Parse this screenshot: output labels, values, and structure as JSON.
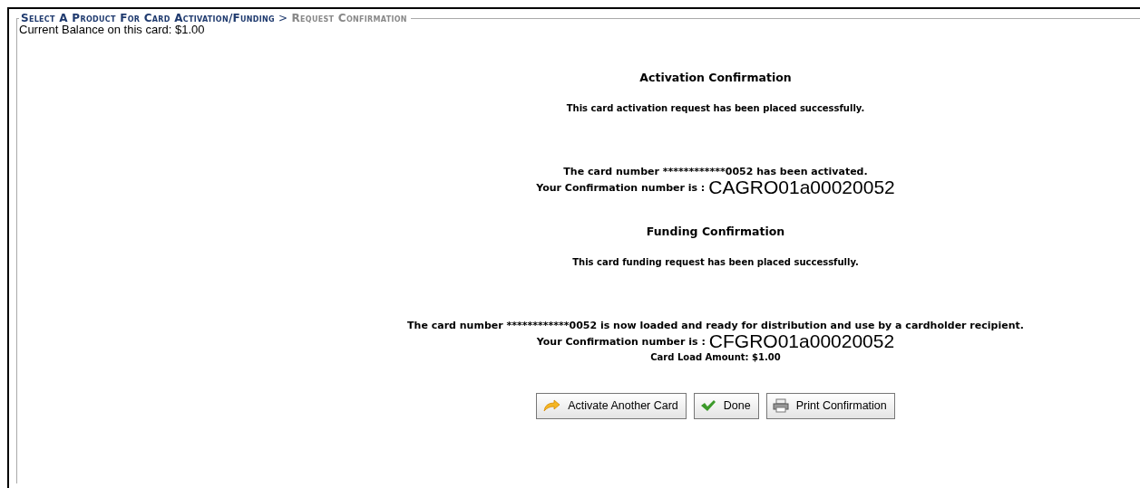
{
  "breadcrumb": {
    "separator": ">",
    "items": [
      {
        "label": "Select A Product For Card Activation/Funding",
        "current": false
      },
      {
        "label": "Request Confirmation",
        "current": true
      }
    ]
  },
  "balance": "Current Balance on this card: $1.00",
  "sections": [
    {
      "title": "Activation Confirmation",
      "message": "This card activation request has been placed successfully.",
      "card_line": "The card number ************0052 has been activated.",
      "confirmation_label": "Your Confirmation number is :",
      "confirmation_number": "CAGRO01a00020052"
    },
    {
      "title": "Funding Confirmation",
      "message": "This card funding request has been placed successfully.",
      "card_line": "The card number ************0052 is now loaded and ready for distribution and use by a cardholder recipient.",
      "confirmation_label": "Your Confirmation number is :",
      "confirmation_number": "CFGRO01a00020052",
      "load_amount": "Card Load Amount: $1.00"
    }
  ],
  "buttons": [
    {
      "kind": "refresh",
      "label": "Activate Another Card"
    },
    {
      "kind": "check",
      "label": "Done"
    },
    {
      "kind": "print",
      "label": "Print Confirmation"
    }
  ]
}
